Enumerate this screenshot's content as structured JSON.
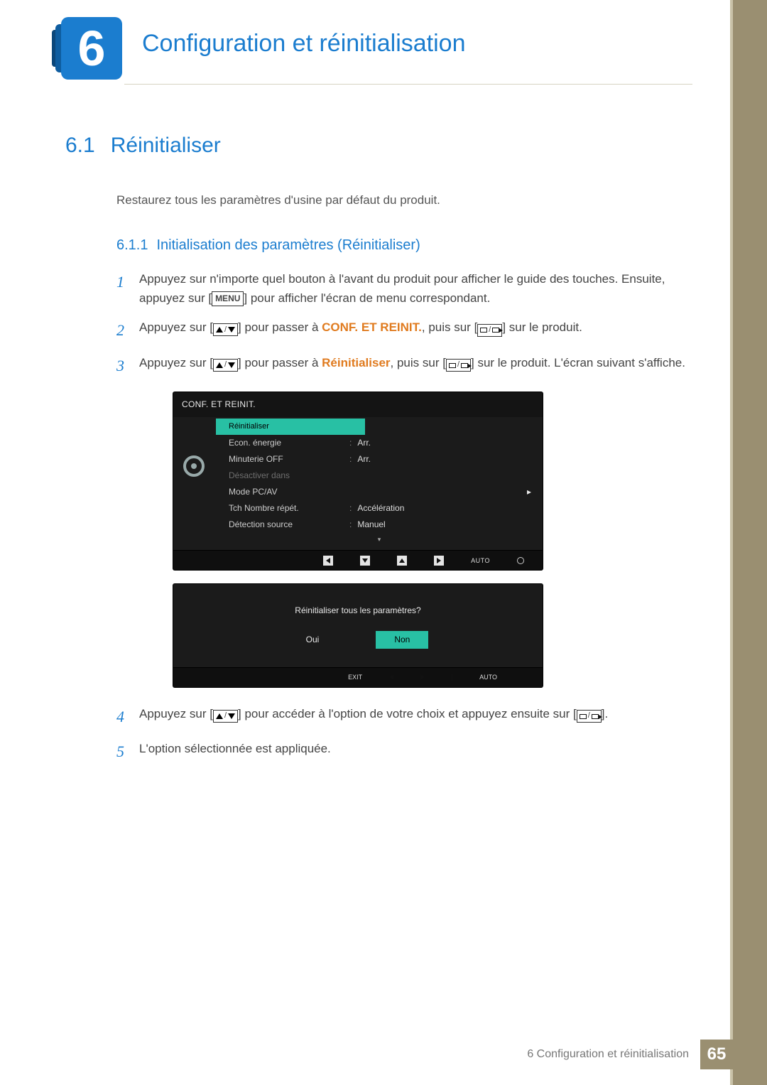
{
  "chapter": {
    "number": "6",
    "title": "Configuration et réinitialisation"
  },
  "section": {
    "number": "6.1",
    "title": "Réinitialiser"
  },
  "intro": "Restaurez tous les paramètres d'usine par défaut du produit.",
  "subsection": {
    "number": "6.1.1",
    "title": "Initialisation des paramètres (Réinitialiser)"
  },
  "steps": {
    "s1": {
      "num": "1",
      "a": "Appuyez sur n'importe quel bouton à l'avant du produit pour afficher le guide des touches. Ensuite, appuyez sur [",
      "menu": "MENU",
      "b": "] pour afficher l'écran de menu correspondant."
    },
    "s2": {
      "num": "2",
      "a": "Appuyez sur [",
      "b": "] pour passer à ",
      "kw": "CONF. ET REINIT.",
      "c": ", puis sur [",
      "d": "] sur le produit."
    },
    "s3": {
      "num": "3",
      "a": "Appuyez sur [",
      "b": "] pour passer à ",
      "kw": "Réinitialiser",
      "c": ", puis sur [",
      "d": "] sur le produit. L'écran suivant s'affiche."
    },
    "s4": {
      "num": "4",
      "a": "Appuyez sur [",
      "b": "] pour accéder à l'option de votre choix et appuyez ensuite sur [",
      "c": "]."
    },
    "s5": {
      "num": "5",
      "text": "L'option sélectionnée est appliquée."
    }
  },
  "osd": {
    "title": "CONF. ET REINIT.",
    "rows": [
      {
        "label": "Réinitialiser",
        "value": "",
        "type": "sel"
      },
      {
        "label": "Econ. énergie",
        "value": "Arr."
      },
      {
        "label": "Minuterie OFF",
        "value": "Arr."
      },
      {
        "label": "Désactiver dans",
        "value": "",
        "type": "dis"
      },
      {
        "label": "Mode PC/AV",
        "value": "",
        "chevron": true
      },
      {
        "label": "Tch Nombre répét.",
        "value": "Accélération"
      },
      {
        "label": "Détection source",
        "value": "Manuel"
      }
    ],
    "bar": {
      "auto": "AUTO"
    }
  },
  "osd2": {
    "question": "Réinitialiser tous les paramètres?",
    "yes": "Oui",
    "no": "Non",
    "exit": "EXIT",
    "auto": "AUTO"
  },
  "footer": {
    "text": "6 Configuration et réinitialisation",
    "page": "65"
  }
}
